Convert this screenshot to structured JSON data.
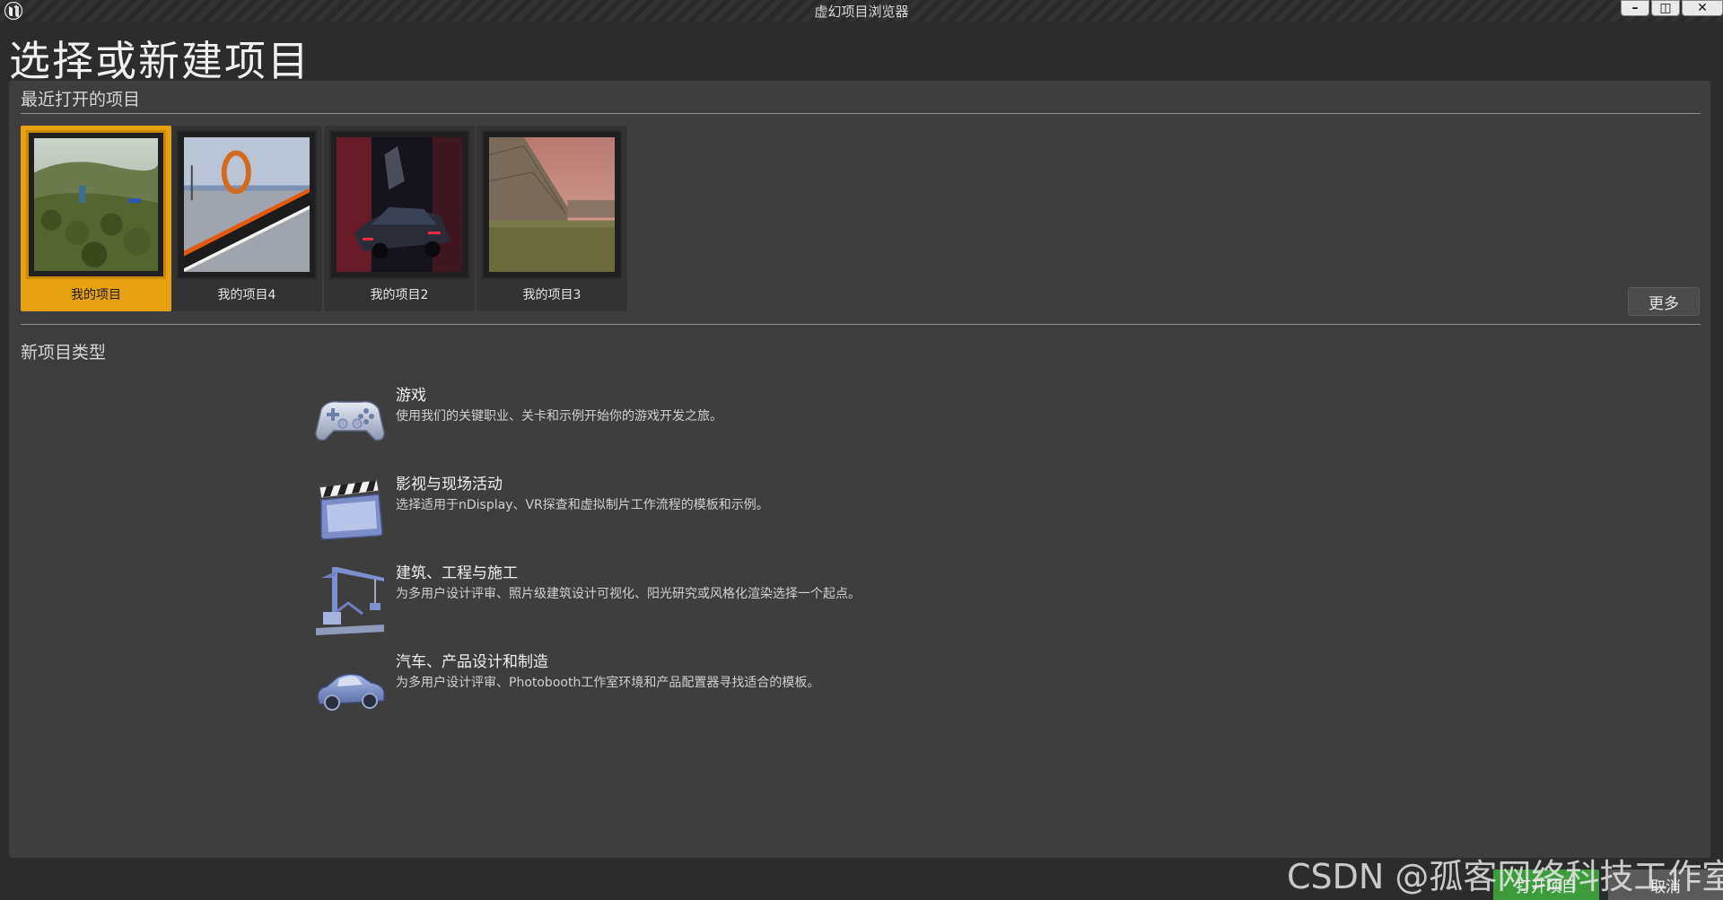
{
  "window": {
    "title": "虚幻项目浏览器",
    "minimize_glyph": "–",
    "restore_glyph": "◫",
    "close_glyph": "✕"
  },
  "page_title": "选择或新建项目",
  "recent": {
    "heading": "最近打开的项目",
    "projects": [
      {
        "label": "我的项目",
        "selected": true,
        "thumbnail": "grassy-landscape-thumbnail"
      },
      {
        "label": "我的项目4",
        "selected": false,
        "thumbnail": "loop-track-thumbnail"
      },
      {
        "label": "我的项目2",
        "selected": false,
        "thumbnail": "red-car-thumbnail"
      },
      {
        "label": "我的项目3",
        "selected": false,
        "thumbnail": "desert-wall-thumbnail"
      }
    ],
    "more_label": "更多"
  },
  "new_types": {
    "heading": "新项目类型",
    "categories": [
      {
        "title": "游戏",
        "description": "使用我们的关键职业、关卡和示例开始你的游戏开发之旅。",
        "icon": "gamepad-icon"
      },
      {
        "title": "影视与现场活动",
        "description": "选择适用于nDisplay、VR探查和虚拟制片工作流程的模板和示例。",
        "icon": "clapperboard-icon"
      },
      {
        "title": "建筑、工程与施工",
        "description": "为多用户设计评审、照片级建筑设计可视化、阳光研究或风格化渲染选择一个起点。",
        "icon": "crane-icon"
      },
      {
        "title": "汽车、产品设计和制造",
        "description": "为多用户设计评审、Photobooth工作室环境和产品配置器寻找适合的模板。",
        "icon": "car-icon"
      }
    ]
  },
  "footer": {
    "open_label": "打开项目",
    "cancel_label": "取消"
  },
  "watermark": "CSDN @孤客网络科技工作室",
  "colors": {
    "accent_selected": "#e6a010",
    "open_button": "#3e9b3c",
    "panel": "#3e3e3e",
    "background": "#2c2c2c"
  }
}
